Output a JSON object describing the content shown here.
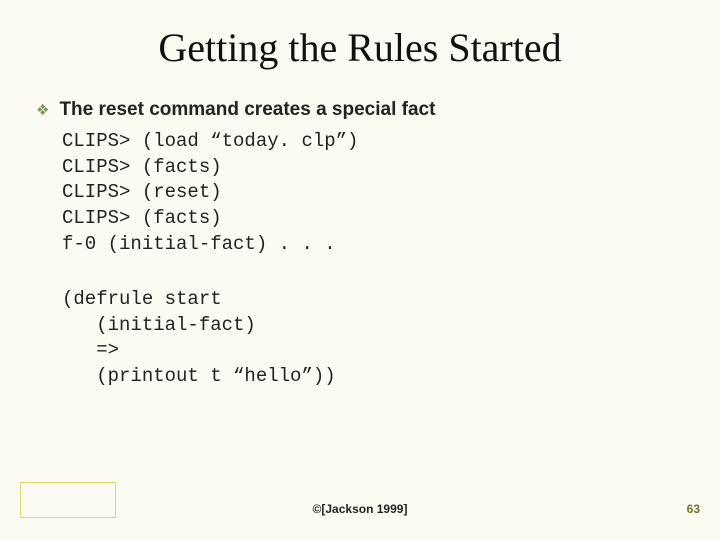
{
  "title": "Getting the Rules Started",
  "bullet": {
    "glyph": "❖",
    "text": "The reset command creates a special fact"
  },
  "code1": "CLIPS> (load “today. clp”)\nCLIPS> (facts)\nCLIPS> (reset)\nCLIPS> (facts)\nf-0 (initial-fact) . . .",
  "code2": "(defrule start\n   (initial-fact)\n   =>\n   (printout t “hello”))",
  "copyright": "©[Jackson 1999]",
  "page_number": "63"
}
